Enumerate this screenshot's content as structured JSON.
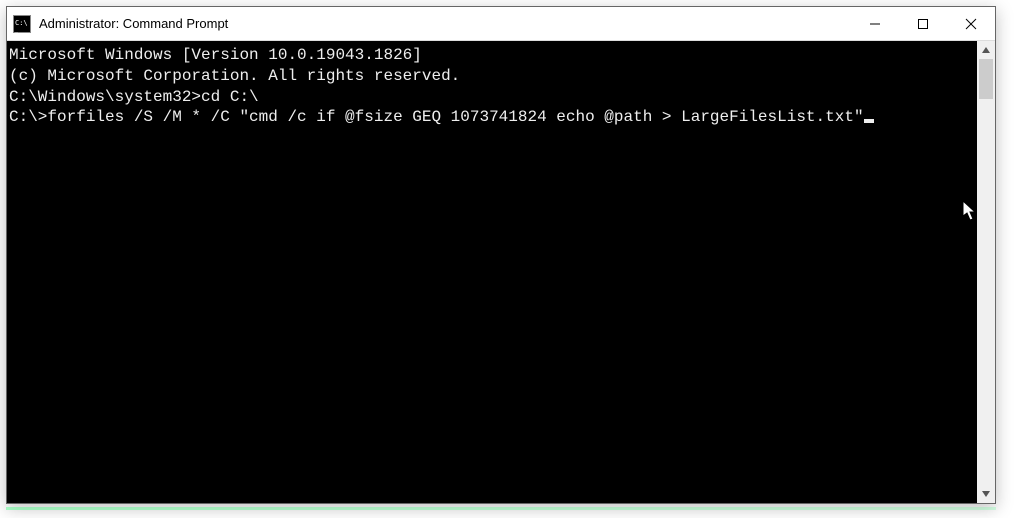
{
  "window": {
    "title": "Administrator: Command Prompt"
  },
  "terminal": {
    "banner1": "Microsoft Windows [Version 10.0.19043.1826]",
    "banner2": "(c) Microsoft Corporation. All rights reserved.",
    "blank1": "",
    "prompt1": "C:\\Windows\\system32>",
    "cmd1": "cd C:\\",
    "blank2": "",
    "prompt2": "C:\\>",
    "cmd2": "forfiles /S /M * /C \"cmd /c if @fsize GEQ 1073741824 echo @path > LargeFilesList.txt\""
  }
}
